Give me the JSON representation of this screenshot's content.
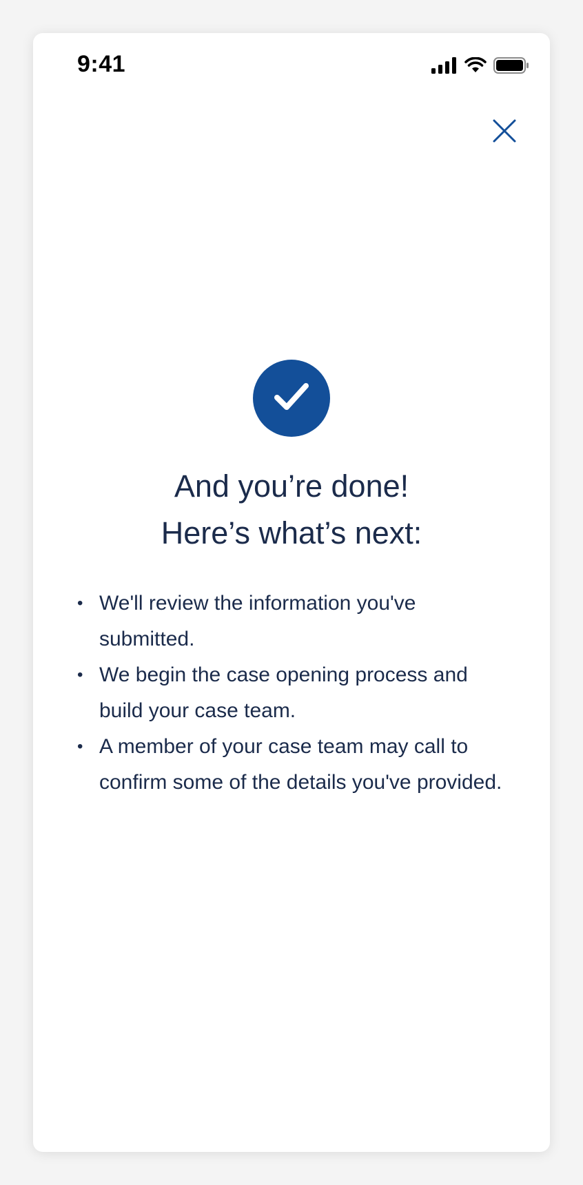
{
  "status_bar": {
    "time": "9:41",
    "icons": [
      "cellular-signal-icon",
      "wifi-icon",
      "battery-icon"
    ]
  },
  "header": {
    "close_icon": "close-icon"
  },
  "confirmation": {
    "icon": "checkmark-icon",
    "title_line1": "And you’re done!",
    "title_line2": "Here’s what’s next:",
    "bullet_glyph": "•",
    "steps": [
      "We'll review the information you've submitted.",
      "We begin the case opening process and build your case team.",
      "A member of your case team may call to confirm some of the details you've provided."
    ]
  },
  "colors": {
    "accent": "#134f99",
    "text": "#1b2b4b",
    "background": "#f4f4f4",
    "card": "#ffffff"
  }
}
